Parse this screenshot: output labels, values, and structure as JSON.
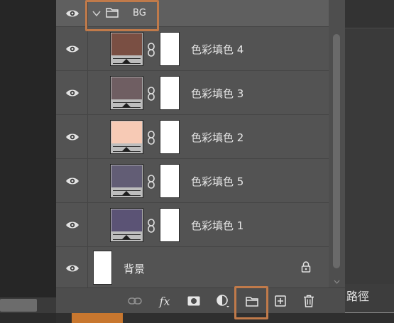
{
  "panel": {
    "group": {
      "name": "BG",
      "icon": "folder-icon"
    },
    "layers": [
      {
        "name": "色彩填色 4",
        "swatch": "#7a4f43"
      },
      {
        "name": "色彩填色 3",
        "swatch": "#6f5e62"
      },
      {
        "name": "色彩填色 2",
        "swatch": "#f7cab5"
      },
      {
        "name": "色彩填色 5",
        "swatch": "#625d75"
      },
      {
        "name": "色彩填色 1",
        "swatch": "#5b5375"
      }
    ],
    "background_layer": {
      "name": "背景"
    }
  },
  "toolbar": {
    "buttons": [
      {
        "name": "link-layers-icon"
      },
      {
        "name": "fx-icon",
        "label": "fx"
      },
      {
        "name": "add-mask-icon"
      },
      {
        "name": "adjustment-layer-icon"
      },
      {
        "name": "new-group-icon"
      },
      {
        "name": "new-layer-icon"
      },
      {
        "name": "delete-layer-icon"
      }
    ]
  },
  "side_tab": {
    "label": "路徑"
  },
  "colors": {
    "highlight": "#c07a4a",
    "panel_bg": "#535353",
    "selected_row": "#5f5f5f",
    "accent": "#c8772f"
  }
}
